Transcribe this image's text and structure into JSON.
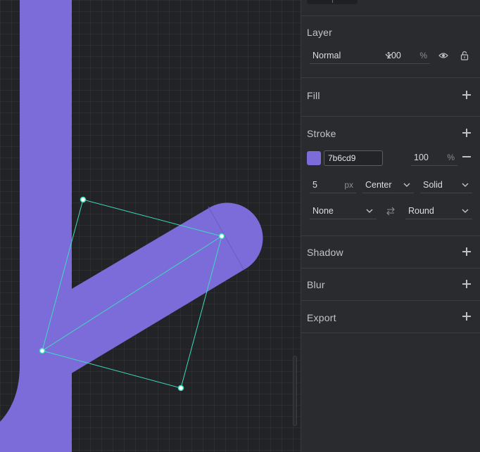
{
  "canvas": {
    "stroke_color": "#7b6cd9",
    "handle_color": "#3ddbbd"
  },
  "panel": {
    "layer": {
      "title": "Layer",
      "blend_mode": "Normal",
      "opacity": "100",
      "opacity_unit": "%",
      "icons": [
        "eye-icon",
        "unlock-icon"
      ]
    },
    "fill": {
      "title": "Fill"
    },
    "stroke": {
      "title": "Stroke",
      "color_hex": "7b6cd9",
      "color": "#7b6cd9",
      "opacity": "100",
      "opacity_unit": "%",
      "width": "5",
      "width_unit": "px",
      "position": "Center",
      "style": "Solid",
      "cap_start": "None",
      "cap_end": "Round",
      "swap_icon": "swap-arrows-icon"
    },
    "shadow": {
      "title": "Shadow"
    },
    "blur": {
      "title": "Blur"
    },
    "export": {
      "title": "Export"
    }
  }
}
